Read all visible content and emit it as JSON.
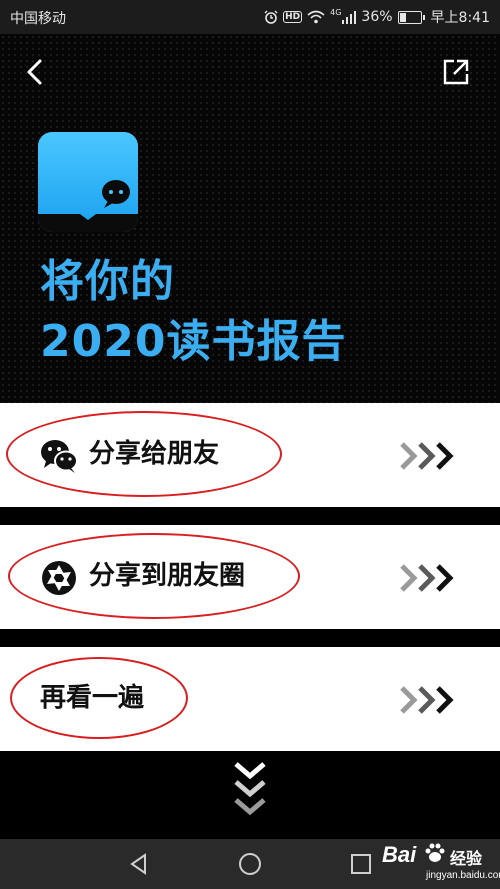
{
  "status_bar": {
    "carrier": "中国移动",
    "network": "4G",
    "hd": "HD",
    "battery": "36%",
    "battery_level": 0.36,
    "time": "早上8:41"
  },
  "header": {
    "title_line1": "将你的",
    "title_line2": "2020读书报告",
    "accent_color": "#3aaef0"
  },
  "actions": [
    {
      "label": "分享给朋友",
      "icon": "wechat-icon"
    },
    {
      "label": "分享到朋友圈",
      "icon": "moments-shutter-icon"
    },
    {
      "label": "再看一遍"
    }
  ],
  "highlight_color": "#d81e1e",
  "watermark": {
    "brand": "Bai",
    "brand_cn": "经验",
    "url": "jingyan.baidu.com"
  }
}
